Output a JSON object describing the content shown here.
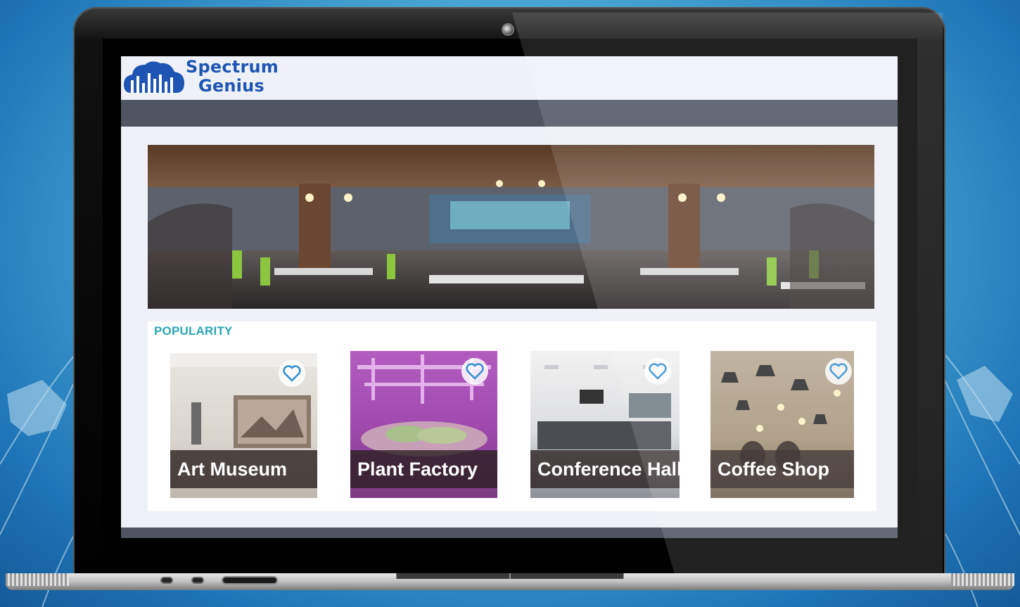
{
  "brand": {
    "name_line1": "Spectrum",
    "name_line2": "Genius",
    "color": "#1e55b4"
  },
  "section": {
    "title": "POPULARITY",
    "title_color": "#2aa6b5"
  },
  "cards": [
    {
      "label": "Art Museum",
      "icon": "heart-icon"
    },
    {
      "label": "Plant Factory",
      "icon": "heart-icon"
    },
    {
      "label": "Conference Hall",
      "icon": "heart-icon"
    },
    {
      "label": "Coffee Shop",
      "icon": "heart-icon"
    }
  ],
  "colors": {
    "navbar": "#4e5662",
    "heart": "#2f8fd6"
  }
}
